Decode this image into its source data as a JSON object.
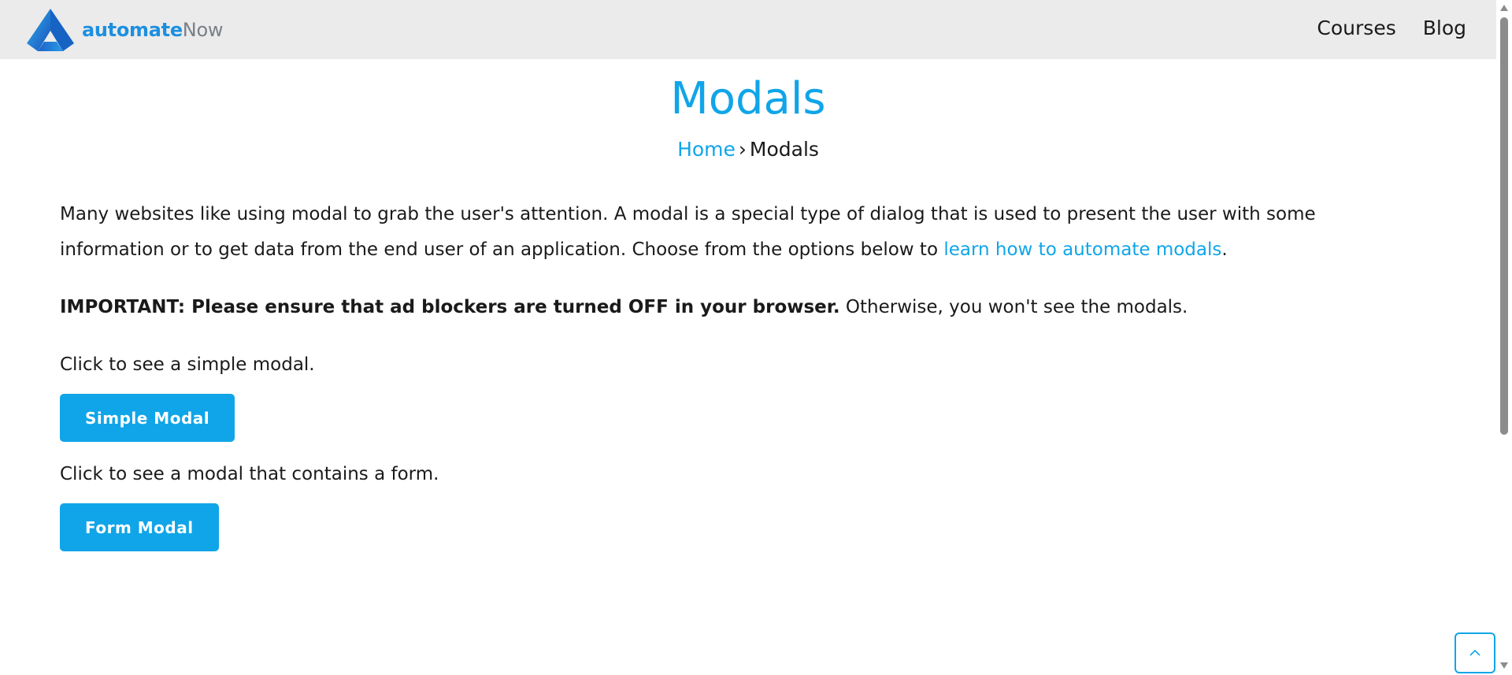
{
  "header": {
    "logo": {
      "bold": "automate",
      "light": "Now"
    },
    "nav": [
      {
        "label": "Courses"
      },
      {
        "label": "Blog"
      }
    ]
  },
  "page": {
    "title": "Modals",
    "breadcrumb": {
      "home": "Home",
      "separator": "›",
      "current": "Modals"
    }
  },
  "content": {
    "intro_text": "Many websites like using modal to grab the user's attention. A modal is a special type of dialog that is used to present the user with some information or to get data from the end user of an application. Choose from the options below to ",
    "intro_link": "learn how to automate modals",
    "intro_end": ".",
    "important_bold": "IMPORTANT: Please ensure that ad blockers are turned OFF in your browser.",
    "important_rest": " Otherwise, you won't see the modals.",
    "simple_prompt": "Click to see a simple modal.",
    "simple_button": "Simple Modal",
    "form_prompt": "Click to see a modal that contains a form.",
    "form_button": "Form Modal"
  },
  "icons": {
    "logo": "automatenow-logo-icon",
    "back_to_top": "chevron-up-icon"
  },
  "colors": {
    "accent": "#10a5e8",
    "header_bg": "#ebebeb",
    "text": "#1a1a1a"
  }
}
